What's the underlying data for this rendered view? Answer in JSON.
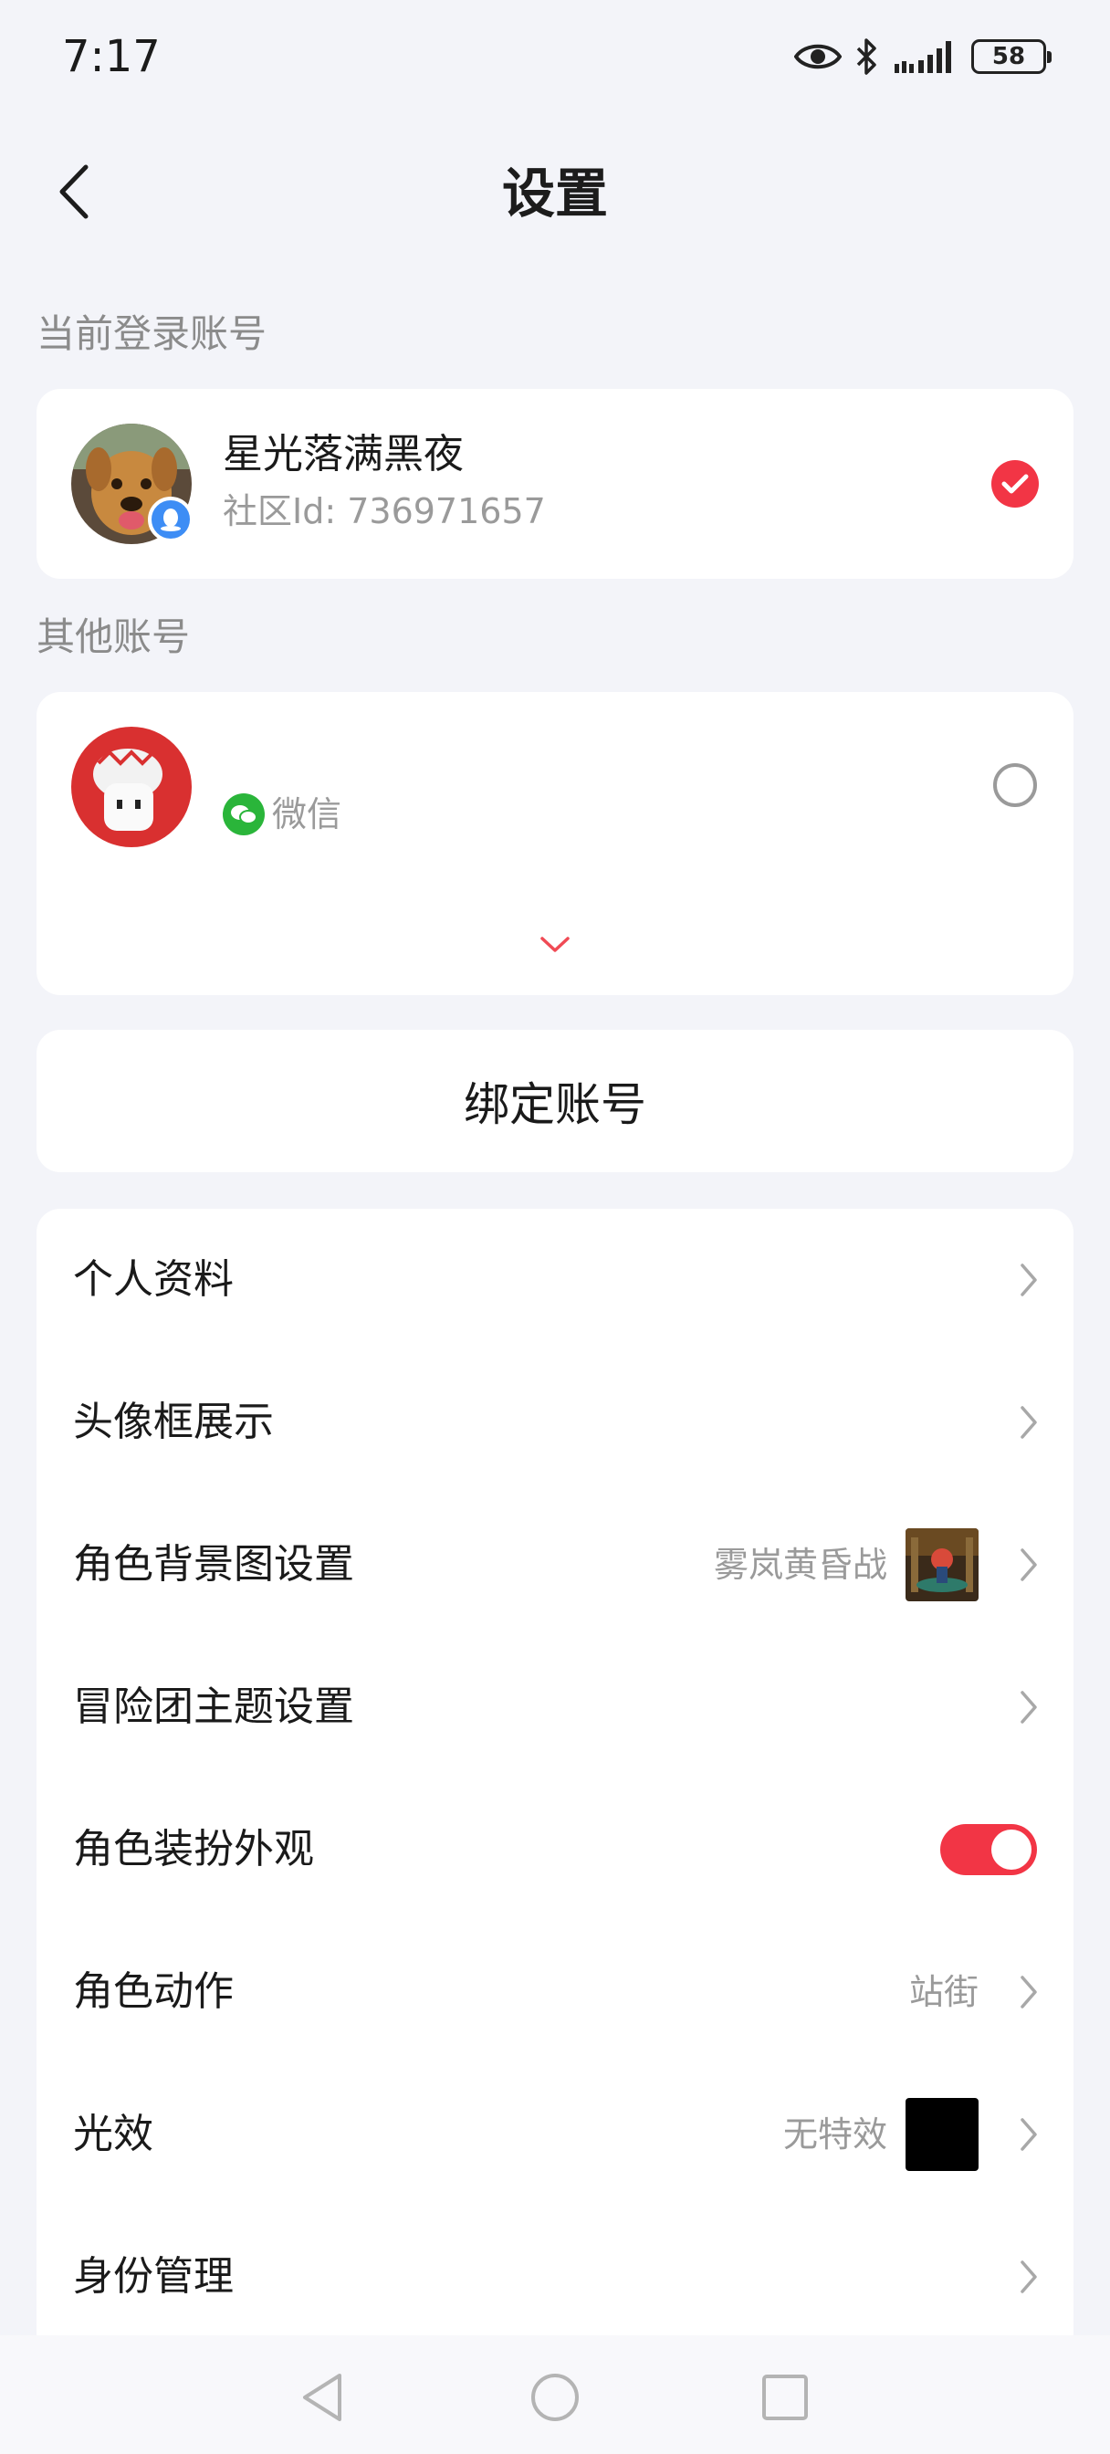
{
  "status_bar": {
    "time": "7:17",
    "battery": "58",
    "icons": [
      "eye-icon",
      "bluetooth-icon",
      "signal-icon",
      "battery-icon"
    ]
  },
  "header": {
    "title": "设置",
    "back_icon": "chevron-left-icon"
  },
  "current_account": {
    "section_label": "当前登录账号",
    "name": "星光落满黑夜",
    "community_id": "社区Id: 736971657",
    "platform_badge": "qq-icon",
    "selected": true
  },
  "other_accounts": {
    "section_label": "其他账号",
    "items": [
      {
        "name": "",
        "platform_label": "微信",
        "platform_icon": "wechat-icon",
        "selected": false
      }
    ],
    "expand_icon": "chevron-down-icon"
  },
  "bind_button": {
    "label": "绑定账号"
  },
  "menu": {
    "items": [
      {
        "label": "个人资料",
        "value": "",
        "type": "link"
      },
      {
        "label": "头像框展示",
        "value": "",
        "type": "link"
      },
      {
        "label": "角色背景图设置",
        "value": "雾岚黄昏战",
        "type": "link-thumb"
      },
      {
        "label": "冒险团主题设置",
        "value": "",
        "type": "link"
      },
      {
        "label": "角色装扮外观",
        "value": "",
        "type": "toggle",
        "enabled": true
      },
      {
        "label": "角色动作",
        "value": "站街",
        "type": "link"
      },
      {
        "label": "光效",
        "value": "无特效",
        "type": "link-thumb"
      },
      {
        "label": "身份管理",
        "value": "",
        "type": "link"
      }
    ]
  },
  "colors": {
    "accent": "#f23545",
    "background": "#f3f4f9",
    "card": "#ffffff",
    "secondary_text": "#9a9a9a"
  },
  "nav_bar": {
    "icons": [
      "nav-back-icon",
      "nav-home-icon",
      "nav-recents-icon"
    ]
  }
}
